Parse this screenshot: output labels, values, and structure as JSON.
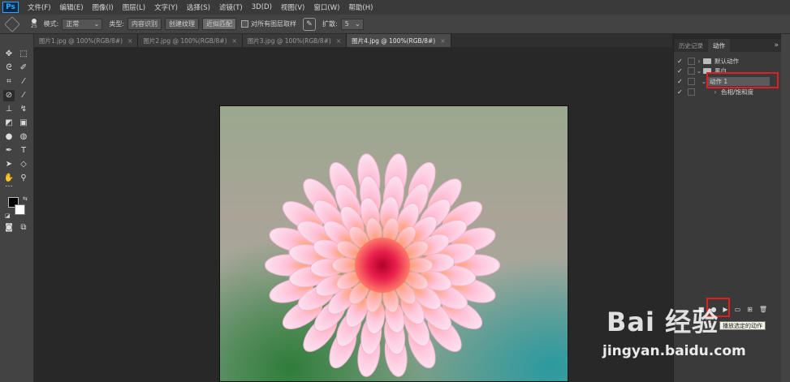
{
  "app": {
    "logo": "Ps"
  },
  "menu": [
    "文件(F)",
    "编辑(E)",
    "图像(I)",
    "图层(L)",
    "文字(Y)",
    "选择(S)",
    "滤镜(T)",
    "3D(D)",
    "视图(V)",
    "窗口(W)",
    "帮助(H)"
  ],
  "options": {
    "brush_size": "25",
    "mode_label": "模式:",
    "mode_value": "正常",
    "type_label": "类型:",
    "type_btn1": "内容识别",
    "type_btn2": "创建纹理",
    "type_btn3": "近似匹配",
    "sample_all": "对所有图层取样",
    "diffusion_label": "扩散:",
    "diffusion_value": "5"
  },
  "tabs": [
    {
      "label": "图片1.jpg @ 100%(RGB/8#)"
    },
    {
      "label": "图片2.jpg @ 100%(RGB/8#)"
    },
    {
      "label": "图片3.jpg @ 100%(RGB/8#)"
    },
    {
      "label": "图片4.jpg @ 100%(RGB/8#)"
    }
  ],
  "panel": {
    "tab_history": "历史记录",
    "tab_actions": "动作",
    "more": "»",
    "rows": [
      {
        "label": "默认动作"
      },
      {
        "label": "黑白"
      },
      {
        "label": "动作 1"
      },
      {
        "label": "色相/饱和度"
      }
    ],
    "tooltip": "播放选定的动作"
  },
  "watermark": {
    "line1": "Bai 经验",
    "line2": "jingyan.baidu.com"
  },
  "colors": {
    "accent": "#31a8ff",
    "highlight": "#e0201e"
  }
}
